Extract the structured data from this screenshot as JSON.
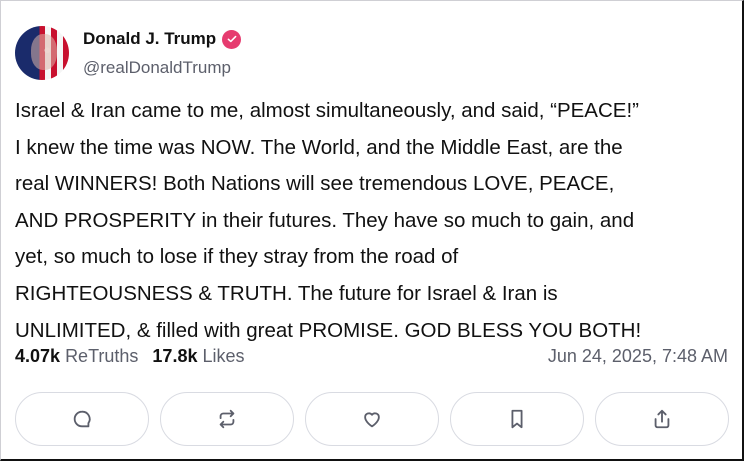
{
  "author": {
    "display_name": "Donald J. Trump",
    "handle": "@realDonaldTrump",
    "avatar_icon": "avatar-flag-portrait",
    "verified_icon": "verified-badge-icon",
    "verified_color": "#e63b6f"
  },
  "post": {
    "text": "Israel & Iran came to me, almost simultaneously, and said, “PEACE!” I knew the time was NOW. The World, and the Middle East, are the real WINNERS! Both Nations will see tremendous LOVE, PEACE, AND PROSPERITY in their futures. They have so much to gain, and yet, so much to lose if they stray from the road of RIGHTEOUSNESS & TRUTH. The future for Israel & Iran is UNLIMITED, & filled with great PROMISE. GOD BLESS YOU BOTH!",
    "lines": [
      "Israel & Iran came to me, almost simultaneously, and said, “PEACE!”",
      "I knew the time was NOW. The World, and the Middle East, are the",
      "real WINNERS! Both Nations will see tremendous LOVE, PEACE,",
      "AND PROSPERITY in their futures. They have so much to gain, and",
      "yet, so much to lose if they stray from the road of",
      "RIGHTEOUSNESS & TRUTH. The future for Israel & Iran is",
      "UNLIMITED, & filled with great PROMISE. GOD BLESS YOU BOTH!"
    ]
  },
  "stats": {
    "retruths_count": "4.07k",
    "retruths_label": "ReTruths",
    "likes_count": "17.8k",
    "likes_label": "Likes",
    "timestamp": "Jun 24, 2025, 7:48 AM"
  },
  "actions": [
    {
      "name": "reply",
      "icon": "comment-icon"
    },
    {
      "name": "retruth",
      "icon": "repost-icon"
    },
    {
      "name": "like",
      "icon": "heart-icon"
    },
    {
      "name": "bookmark",
      "icon": "bookmark-icon"
    },
    {
      "name": "share",
      "icon": "share-icon"
    }
  ]
}
